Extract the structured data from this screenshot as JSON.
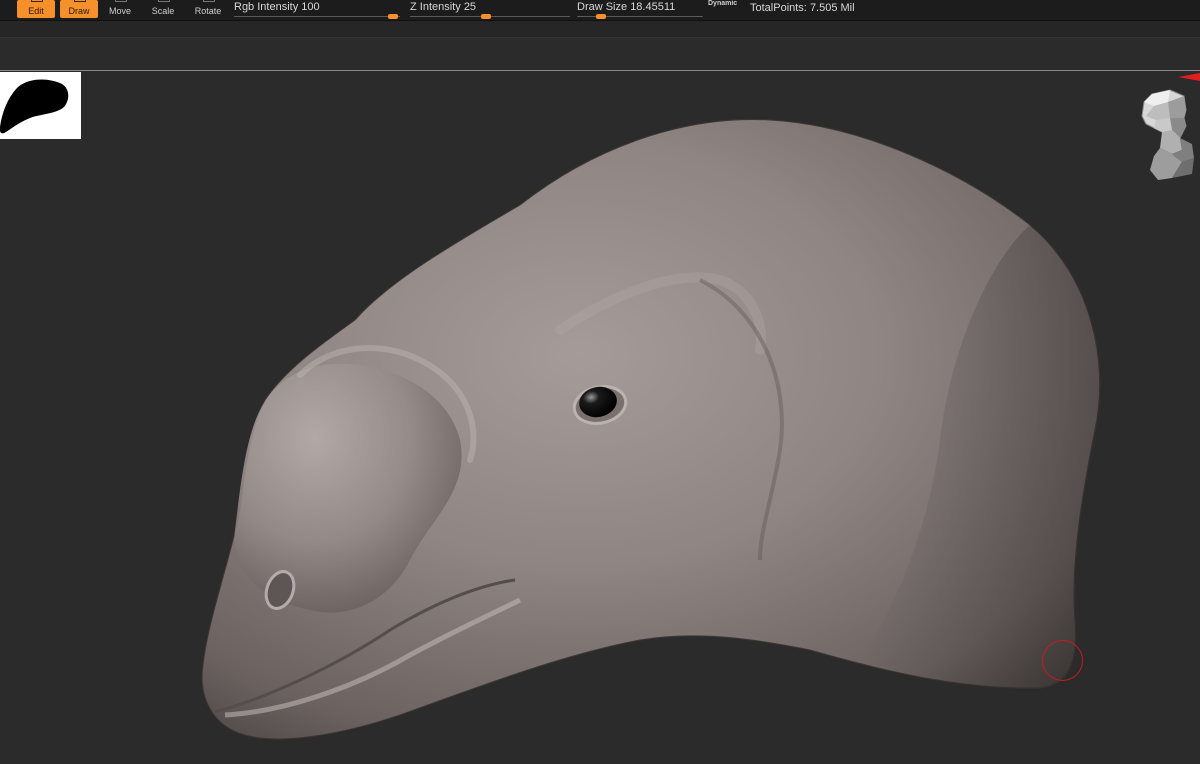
{
  "toolbar": {
    "edit_label": "Edit",
    "draw_label": "Draw",
    "move_label": "Move",
    "scale_label": "Scale",
    "rotate_label": "Rotate",
    "active_color": "#f5902a"
  },
  "sliders": {
    "rgb_intensity": {
      "label": "Rgb Intensity",
      "value": "100"
    },
    "z_intensity": {
      "label": "Z Intensity",
      "value": "25"
    },
    "draw_size": {
      "label": "Draw Size",
      "value": "18.45511",
      "dynamic_label": "Dynamic"
    }
  },
  "status": {
    "total_points_label": "TotalPoints:",
    "total_points_value": "7.505 Mil"
  },
  "canvas": {
    "background": "#2b2b2b",
    "model_color": "#8f8583",
    "brush_cursor_color": "#c21d1d",
    "nav_icon": "head-navigation-icon"
  }
}
